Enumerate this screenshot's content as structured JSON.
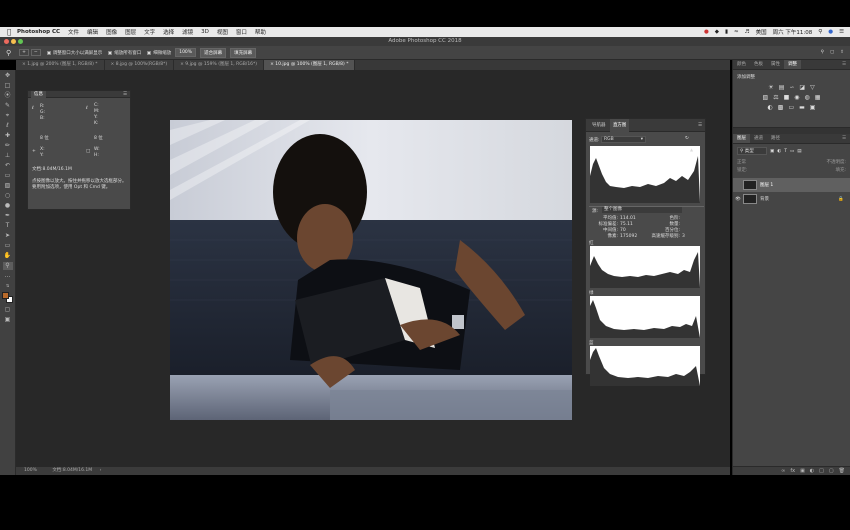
{
  "menubar": {
    "app_name": "Photoshop CC",
    "items": [
      "文件",
      "编辑",
      "图像",
      "图层",
      "文字",
      "选择",
      "滤镜",
      "3D",
      "视图",
      "窗口",
      "帮助"
    ],
    "input_method": "美国",
    "clock": "周六 下午11:08"
  },
  "window": {
    "title": "Adobe Photoshop CC 2018"
  },
  "options_bar": {
    "resize_windows_label": "调整窗口大小以满屏显示",
    "zoom_all_label": "缩放所有窗口",
    "scrubby_zoom_label": "细微缩放",
    "zoom_value": "100%",
    "fit_screen_label": "适合屏幕",
    "fill_screen_label": "填充屏幕"
  },
  "tabs": [
    {
      "label": "1.jpg @ 200% (图层 1, RGB/8) *"
    },
    {
      "label": "8.jpg @ 100%(RGB/8*)"
    },
    {
      "label": "9.jpg @ 159% (图层 1, RGB/16*)"
    },
    {
      "label": "10.jpg @ 100% (图层 1, RGB/8) *"
    }
  ],
  "info_panel": {
    "title": "信息",
    "rgb_labels": [
      "R:",
      "G:",
      "B:"
    ],
    "cmyk_labels": [
      "C:",
      "M:",
      "Y:",
      "K:"
    ],
    "bit_left": "8 位",
    "bit_right": "8 位",
    "xy_labels": [
      "X:",
      "Y:"
    ],
    "wh_labels": [
      "W:",
      "H:"
    ],
    "doc_size": "文档:8.04M/16.1M",
    "hint": "点按图像以放大。按住并拖移以放大选框部分。要用附加选项，使用 Opt 和 Cmd 键。"
  },
  "histogram_panel": {
    "tabs": [
      "导航器",
      "直方图"
    ],
    "channel_label": "通道:",
    "channel_value": "RGB",
    "source_label": "源:",
    "source_value": "整个图像",
    "stats": {
      "mean_label": "平均值:",
      "mean": "114.01",
      "stddev_label": "标准偏差:",
      "stddev": "75.11",
      "median_label": "中间值:",
      "median": "70",
      "pixels_label": "像素:",
      "pixels": "175092",
      "level_label": "色阶:",
      "count_label": "数量:",
      "percentile_label": "百分位:",
      "cache_label": "高速缓存级别:",
      "cache": "3"
    },
    "channels": [
      "红",
      "绿",
      "蓝"
    ]
  },
  "right_dock": {
    "top_tabs": [
      "颜色",
      "色板",
      "属性",
      "调整"
    ],
    "add_adjustment": "添加调整",
    "layers_tabs": [
      "图层",
      "通道",
      "路径"
    ],
    "filter_kind": "类型",
    "blend_mode": "正常",
    "opacity_label": "不透明度:",
    "fill_label": "填充:",
    "lock_label": "锁定:",
    "layers": [
      {
        "name": "图层 1",
        "selected": true
      },
      {
        "name": "背景",
        "selected": false
      }
    ]
  },
  "status_bar": {
    "zoom": "100%",
    "doc": "文档:8.04M/16.1M"
  },
  "colors": {
    "accent": "#1473e6",
    "panel": "#4a4a4a",
    "canvas_bg": "#282828"
  }
}
